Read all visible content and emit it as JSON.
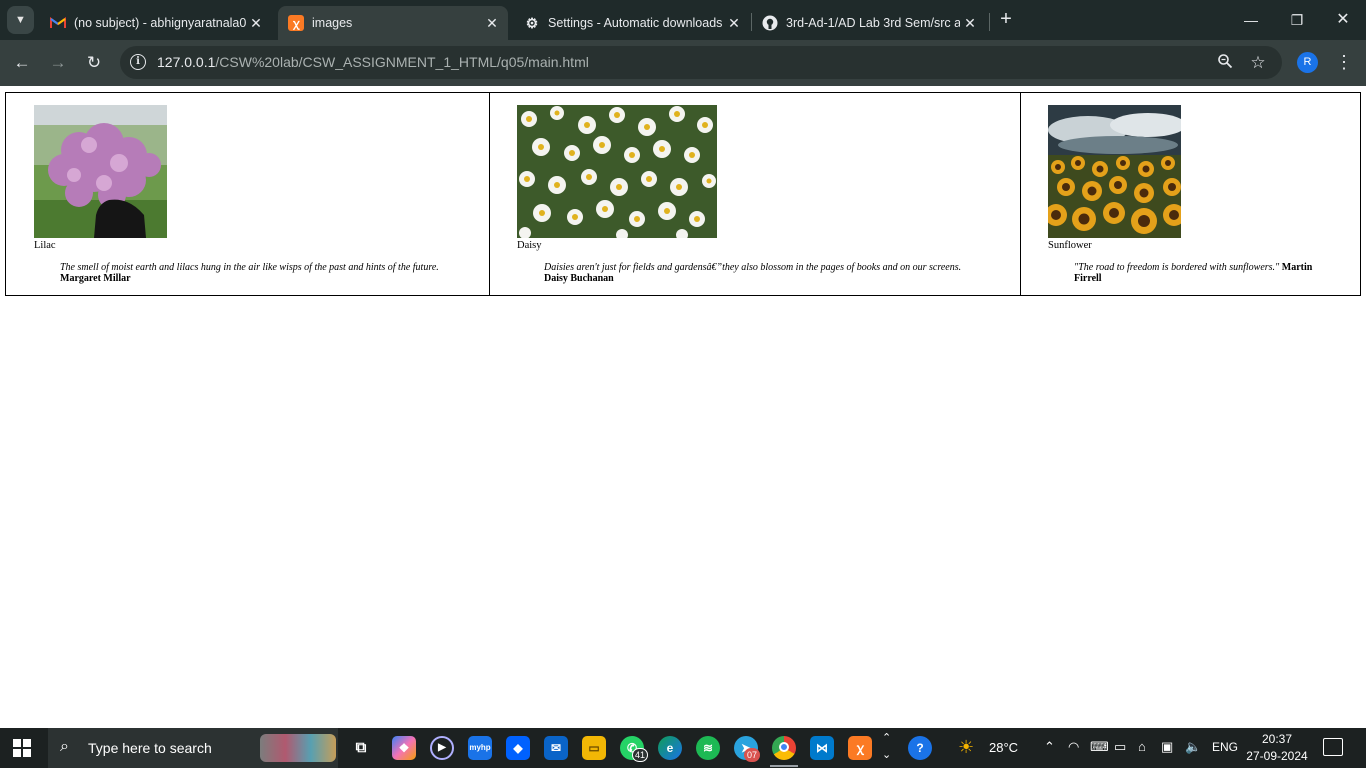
{
  "browser": {
    "tabs": [
      {
        "title": "(no subject) - abhignyaratnala0",
        "icon": "gmail-icon"
      },
      {
        "title": "images",
        "icon": "xampp-icon"
      },
      {
        "title": "Settings - Automatic downloads",
        "icon": "settings-gear-icon"
      },
      {
        "title": "3rd-Ad-1/AD Lab 3rd Sem/src a",
        "icon": "github-icon"
      }
    ],
    "url_host": "127.0.0.1",
    "url_path": "/CSW%20lab/CSW_ASSIGNMENT_1_HTML/q05/main.html",
    "profile_initial": "R",
    "accent_color": "#1a73e8"
  },
  "page": {
    "flowers": [
      {
        "name": "Lilac",
        "quote": "The smell of moist earth and lilacs hung in the air like wisps of the past and hints of the future.",
        "author": "Margaret Millar"
      },
      {
        "name": "Daisy",
        "quote": "Daisies aren't just for fields and gardensâ€”they also blossom in the pages of books and on our screens.",
        "author": "Daisy Buchanan"
      },
      {
        "name": "Sunflower",
        "quote": "\"The road to freedom is bordered with sunflowers.\"",
        "author": "Martin Firrell"
      }
    ]
  },
  "taskbar": {
    "search_placeholder": "Type here to search",
    "whatsapp_badge": "41",
    "telegram_badge": "07",
    "weather": "28°C",
    "language": "ENG",
    "time": "20:37",
    "date": "27-09-2024"
  }
}
